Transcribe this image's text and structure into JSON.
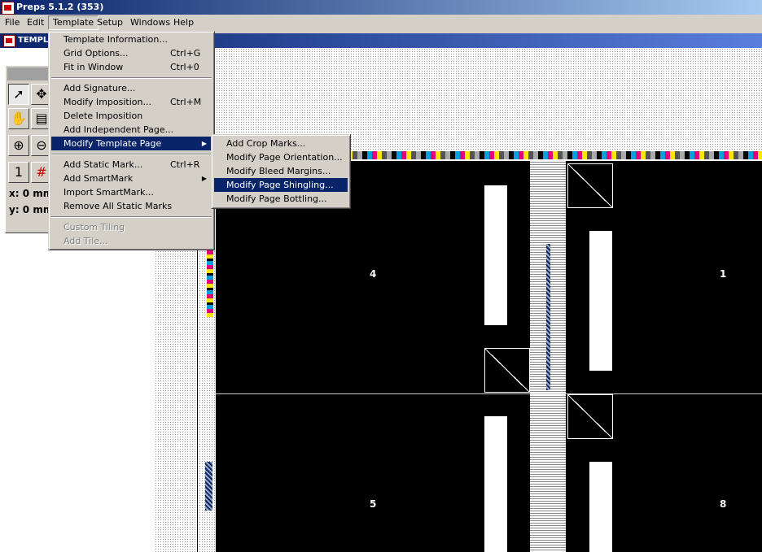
{
  "app": {
    "title": "Preps 5.1.2 (353)"
  },
  "menubar": {
    "file": "File",
    "edit": "Edit",
    "template": "Template",
    "setup": "Setup",
    "windows": "Windows",
    "help": "Help"
  },
  "document": {
    "title": "TEMPL"
  },
  "palette": {
    "x_readout": "x: 0 mm",
    "y_readout": "y: 0 mm"
  },
  "template_menu": {
    "items": [
      {
        "label": "Template Information...",
        "shortcut": ""
      },
      {
        "label": "Grid Options...",
        "shortcut": "Ctrl+G"
      },
      {
        "label": "Fit in Window",
        "shortcut": "Ctrl+0"
      },
      {
        "label": "Add Signature...",
        "shortcut": ""
      },
      {
        "label": "Modify Imposition...",
        "shortcut": "Ctrl+M"
      },
      {
        "label": "Delete Imposition",
        "shortcut": ""
      },
      {
        "label": "Add Independent Page...",
        "shortcut": ""
      },
      {
        "label": "Modify Template Page",
        "shortcut": ""
      },
      {
        "label": "Add Static Mark...",
        "shortcut": "Ctrl+R"
      },
      {
        "label": "Add SmartMark",
        "shortcut": ""
      },
      {
        "label": "Import SmartMark...",
        "shortcut": ""
      },
      {
        "label": "Remove All Static Marks",
        "shortcut": ""
      },
      {
        "label": "Custom Tiling",
        "shortcut": ""
      },
      {
        "label": "Add Tile...",
        "shortcut": ""
      }
    ]
  },
  "submenu": {
    "items": [
      {
        "label": "Add Crop Marks..."
      },
      {
        "label": "Modify Page Orientation..."
      },
      {
        "label": "Modify Bleed Margins..."
      },
      {
        "label": "Modify Page Shingling..."
      },
      {
        "label": "Modify Page Bottling..."
      }
    ]
  },
  "pages": {
    "p4": "4",
    "p1": "1",
    "p5": "5",
    "p8": "8"
  },
  "colors": {
    "selection": "#0a246a",
    "menu_bg": "#d4d0c8",
    "sheet": "#000000"
  }
}
